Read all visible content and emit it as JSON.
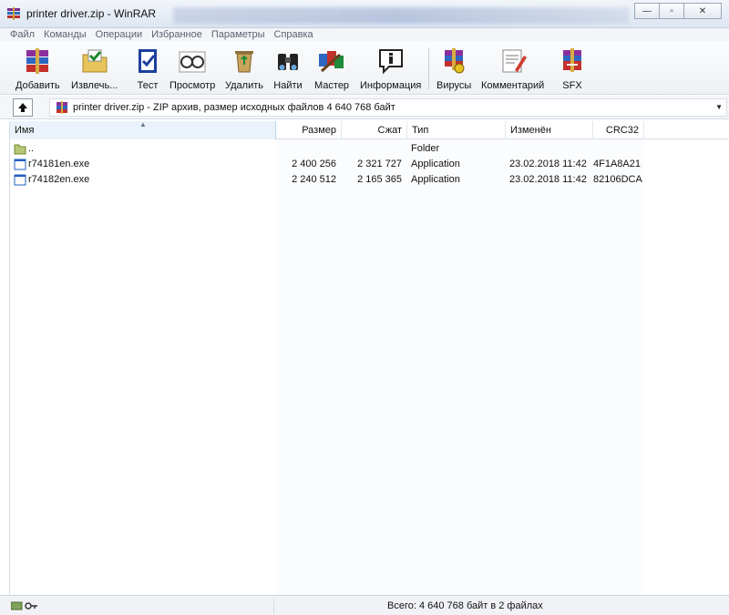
{
  "window": {
    "title": "printer driver.zip - WinRAR",
    "controls": [
      "minimize",
      "maximize",
      "close"
    ]
  },
  "menu": [
    "Файл",
    "Команды",
    "Операции",
    "Избранное",
    "Параметры",
    "Справка"
  ],
  "toolbar": {
    "buttons": [
      {
        "label": "Добавить",
        "icon": "archive-books-icon"
      },
      {
        "label": "Извлечь...",
        "icon": "extract-folder-icon"
      },
      {
        "label": "Тест",
        "icon": "test-check-icon"
      },
      {
        "label": "Просмотр",
        "icon": "glasses-view-icon"
      },
      {
        "label": "Удалить",
        "icon": "recycle-delete-icon"
      },
      {
        "label": "Найти",
        "icon": "binoculars-icon"
      },
      {
        "label": "Мастер",
        "icon": "wizard-icon"
      },
      {
        "label": "Информация",
        "icon": "info-icon"
      },
      {
        "label": "Вирусы",
        "icon": "virus-scan-icon"
      },
      {
        "label": "Комментарий",
        "icon": "comment-pen-icon"
      },
      {
        "label": "SFX",
        "icon": "sfx-icon"
      }
    ]
  },
  "address": {
    "text": "printer driver.zip - ZIP архив, размер исходных файлов 4 640 768 байт"
  },
  "list": {
    "columns": [
      "Имя",
      "Размер",
      "Сжат",
      "Тип",
      "Изменён",
      "CRC32"
    ],
    "rows": [
      {
        "name": "..",
        "size": "",
        "packed": "",
        "type": "Folder",
        "modified": "",
        "crc": "",
        "icon": "folder-up-icon"
      },
      {
        "name": "r74181en.exe",
        "size": "2 400 256",
        "packed": "2 321 727",
        "type": "Application",
        "modified": "23.02.2018 11:42",
        "crc": "4F1A8A21",
        "icon": "exe-file-icon"
      },
      {
        "name": "r74182en.exe",
        "size": "2 240 512",
        "packed": "2 165 365",
        "type": "Application",
        "modified": "23.02.2018 11:42",
        "crc": "82106DCA",
        "icon": "exe-file-icon"
      }
    ]
  },
  "status": {
    "text": "Всего: 4 640 768 байт в 2 файлах"
  }
}
